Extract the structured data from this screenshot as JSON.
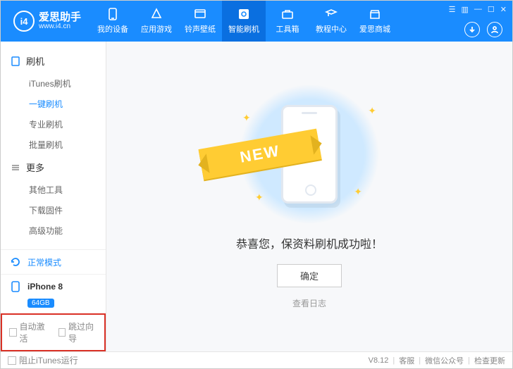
{
  "brand": {
    "name": "爱思助手",
    "site": "www.i4.cn",
    "logo": "i4"
  },
  "nav": [
    {
      "label": "我的设备"
    },
    {
      "label": "应用游戏"
    },
    {
      "label": "铃声壁纸"
    },
    {
      "label": "智能刷机"
    },
    {
      "label": "工具箱"
    },
    {
      "label": "教程中心"
    },
    {
      "label": "爱思商城"
    }
  ],
  "sidebar": {
    "groups": [
      {
        "label": "刷机",
        "items": [
          "iTunes刷机",
          "一键刷机",
          "专业刷机",
          "批量刷机"
        ],
        "selectedIndex": 1
      },
      {
        "label": "更多",
        "items": [
          "其他工具",
          "下载固件",
          "高级功能"
        ]
      }
    ],
    "mode": "正常模式",
    "device": {
      "name": "iPhone 8",
      "capacity": "64GB"
    },
    "options": {
      "autoActivate": "自动激活",
      "skipGuide": "跳过向导"
    }
  },
  "main": {
    "ribbon": "NEW",
    "message": "恭喜您，保资料刷机成功啦！",
    "okBtn": "确定",
    "logLink": "查看日志"
  },
  "footer": {
    "preventItunes": "阻止iTunes运行",
    "version": "V8.12",
    "links": [
      "客服",
      "微信公众号",
      "检查更新"
    ]
  }
}
